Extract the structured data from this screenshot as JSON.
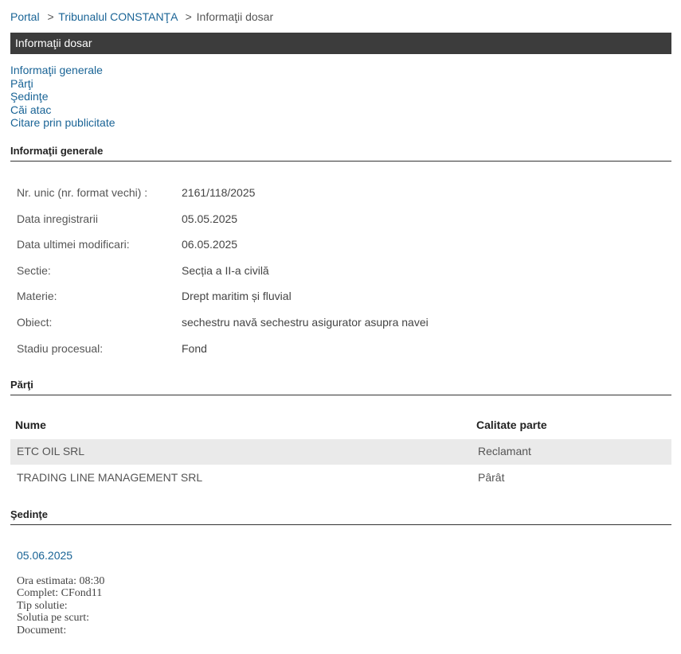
{
  "breadcrumb": {
    "items": [
      {
        "label": "Portal",
        "link": true
      },
      {
        "label": "Tribunalul CONSTANŢA",
        "link": true
      },
      {
        "label": "Informaţii dosar",
        "link": false
      }
    ],
    "separator": ">"
  },
  "page_title": "Informaţii dosar",
  "anchor_nav": [
    "Informaţii generale",
    "Părţi",
    "Şedinţe",
    "Căi atac",
    "Citare prin publicitate"
  ],
  "sections": {
    "informatii_generale": {
      "title": "Informaţii generale",
      "rows": [
        {
          "label": "Nr. unic (nr. format vechi) :",
          "value": "2161/118/2025"
        },
        {
          "label": "Data inregistrarii",
          "value": "05.05.2025"
        },
        {
          "label": "Data ultimei modificari:",
          "value": "06.05.2025"
        },
        {
          "label": "Sectie:",
          "value": "Secția a II-a civilă"
        },
        {
          "label": "Materie:",
          "value": "Drept maritim și fluvial"
        },
        {
          "label": "Obiect:",
          "value": "sechestru navă sechestru asigurator asupra navei"
        },
        {
          "label": "Stadiu procesual:",
          "value": "Fond"
        }
      ]
    },
    "parti": {
      "title": "Părţi",
      "columns": [
        "Nume",
        "Calitate parte"
      ],
      "rows": [
        {
          "name": "ETC OIL SRL",
          "role": "Reclamant"
        },
        {
          "name": "TRADING LINE MANAGEMENT SRL",
          "role": "Pârât"
        }
      ]
    },
    "sedinte": {
      "title": "Şedinţe",
      "date": "05.06.2025",
      "details": [
        "Ora estimata: 08:30",
        "Complet: CFond11",
        "Tip solutie:",
        "Solutia pe scurt:",
        "Document:"
      ]
    }
  },
  "colors": {
    "link": "#1a6496",
    "title_bar": "#3c3c3c",
    "row_shade": "#eaeaea"
  }
}
